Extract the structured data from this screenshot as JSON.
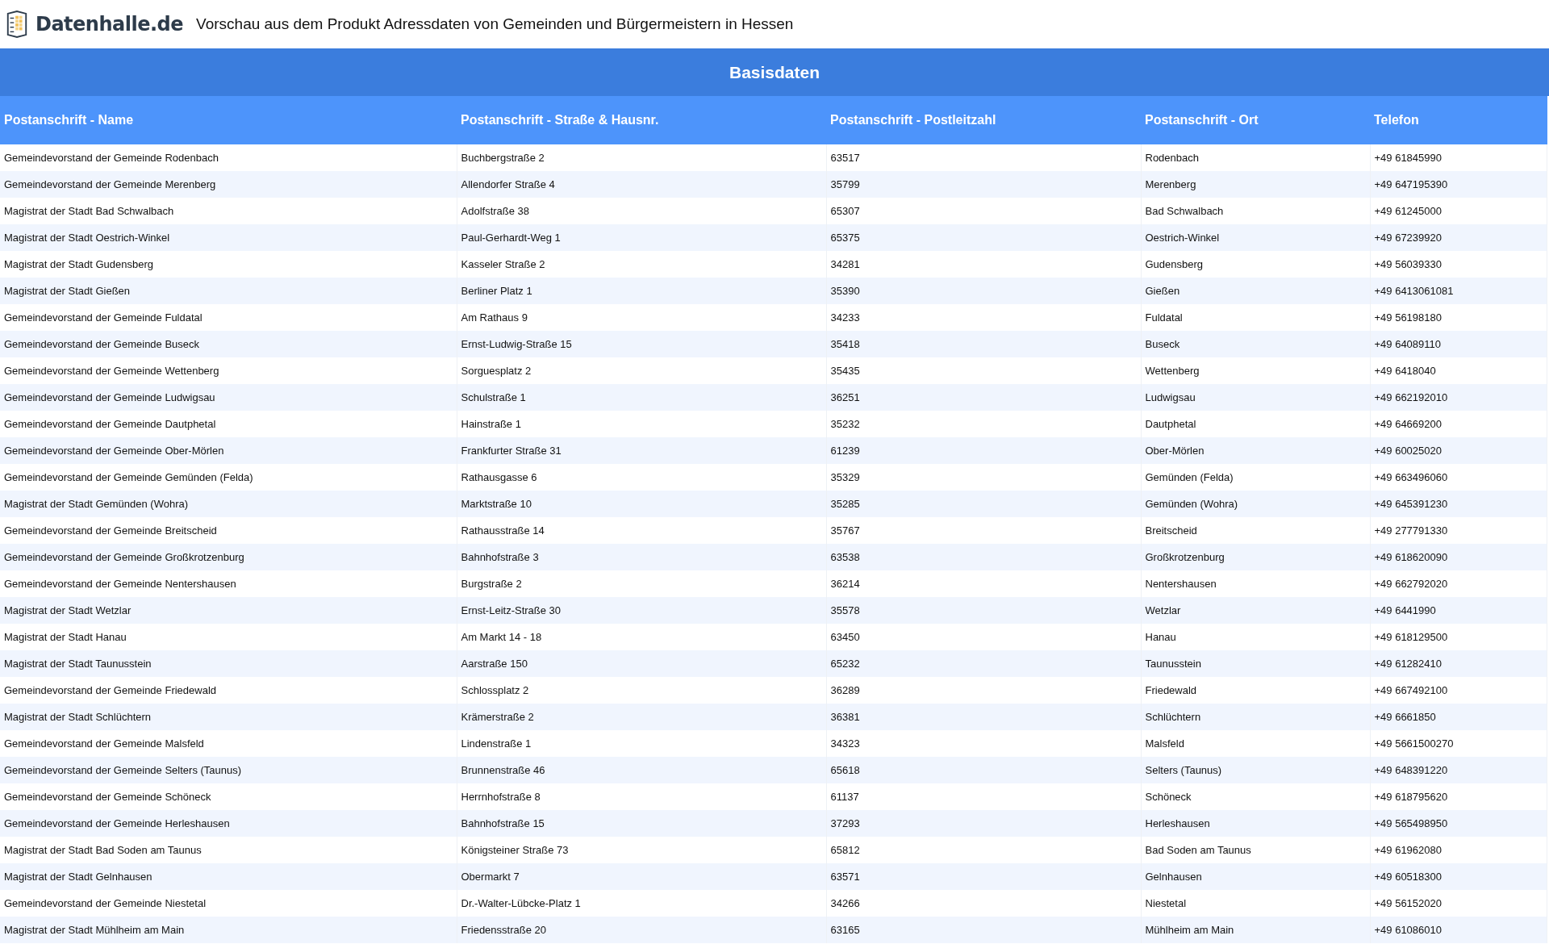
{
  "header": {
    "logo_text": "Datenhalle.de",
    "title": "Vorschau aus dem Produkt Adressdaten von Gemeinden und Bürgermeistern in Hessen"
  },
  "table": {
    "caption": "Basisdaten",
    "columns": [
      "Postanschrift - Name",
      "Postanschrift - Straße & Hausnr.",
      "Postanschrift - Postleitzahl",
      "Postanschrift - Ort",
      "Telefon"
    ],
    "rows": [
      [
        "Gemeindevorstand der Gemeinde Rodenbach",
        "Buchbergstraße 2",
        "63517",
        "Rodenbach",
        "+49 61845990"
      ],
      [
        "Gemeindevorstand der Gemeinde Merenberg",
        "Allendorfer Straße 4",
        "35799",
        "Merenberg",
        "+49 647195390"
      ],
      [
        "Magistrat der Stadt Bad Schwalbach",
        "Adolfstraße 38",
        "65307",
        "Bad Schwalbach",
        "+49 61245000"
      ],
      [
        "Magistrat der Stadt Oestrich-Winkel",
        "Paul-Gerhardt-Weg 1",
        "65375",
        "Oestrich-Winkel",
        "+49 67239920"
      ],
      [
        "Magistrat der Stadt Gudensberg",
        "Kasseler Straße 2",
        "34281",
        "Gudensberg",
        "+49 56039330"
      ],
      [
        "Magistrat der Stadt Gießen",
        "Berliner Platz 1",
        "35390",
        "Gießen",
        "+49 6413061081"
      ],
      [
        "Gemeindevorstand der Gemeinde Fuldatal",
        "Am Rathaus 9",
        "34233",
        "Fuldatal",
        "+49 56198180"
      ],
      [
        "Gemeindevorstand der Gemeinde Buseck",
        "Ernst-Ludwig-Straße 15",
        "35418",
        "Buseck",
        "+49 64089110"
      ],
      [
        "Gemeindevorstand der Gemeinde Wettenberg",
        "Sorguesplatz 2",
        "35435",
        "Wettenberg",
        "+49 6418040"
      ],
      [
        "Gemeindevorstand der Gemeinde Ludwigsau",
        "Schulstraße 1",
        "36251",
        "Ludwigsau",
        "+49 662192010"
      ],
      [
        "Gemeindevorstand der Gemeinde Dautphetal",
        "Hainstraße 1",
        "35232",
        "Dautphetal",
        "+49 64669200"
      ],
      [
        "Gemeindevorstand der Gemeinde Ober-Mörlen",
        "Frankfurter Straße 31",
        "61239",
        "Ober-Mörlen",
        "+49 60025020"
      ],
      [
        "Gemeindevorstand der Gemeinde Gemünden (Felda)",
        "Rathausgasse 6",
        "35329",
        "Gemünden (Felda)",
        "+49 663496060"
      ],
      [
        "Magistrat der Stadt Gemünden (Wohra)",
        "Marktstraße 10",
        "35285",
        "Gemünden (Wohra)",
        "+49 645391230"
      ],
      [
        "Gemeindevorstand der Gemeinde Breitscheid",
        "Rathausstraße 14",
        "35767",
        "Breitscheid",
        "+49 277791330"
      ],
      [
        "Gemeindevorstand der Gemeinde Großkrotzenburg",
        "Bahnhofstraße 3",
        "63538",
        "Großkrotzenburg",
        "+49 618620090"
      ],
      [
        "Gemeindevorstand der Gemeinde Nentershausen",
        "Burgstraße 2",
        "36214",
        "Nentershausen",
        "+49 662792020"
      ],
      [
        "Magistrat der Stadt Wetzlar",
        "Ernst-Leitz-Straße 30",
        "35578",
        "Wetzlar",
        "+49 6441990"
      ],
      [
        "Magistrat der Stadt Hanau",
        "Am Markt 14 - 18",
        "63450",
        "Hanau",
        "+49 618129500"
      ],
      [
        "Magistrat der Stadt Taunusstein",
        "Aarstraße 150",
        "65232",
        "Taunusstein",
        "+49 61282410"
      ],
      [
        "Gemeindevorstand der Gemeinde Friedewald",
        "Schlossplatz 2",
        "36289",
        "Friedewald",
        "+49 667492100"
      ],
      [
        "Magistrat der Stadt Schlüchtern",
        "Krämerstraße 2",
        "36381",
        "Schlüchtern",
        "+49 6661850"
      ],
      [
        "Gemeindevorstand der Gemeinde Malsfeld",
        "Lindenstraße 1",
        "34323",
        "Malsfeld",
        "+49 5661500270"
      ],
      [
        "Gemeindevorstand der Gemeinde Selters (Taunus)",
        "Brunnenstraße 46",
        "65618",
        "Selters (Taunus)",
        "+49 648391220"
      ],
      [
        "Gemeindevorstand der Gemeinde Schöneck",
        "Herrnhofstraße 8",
        "61137",
        "Schöneck",
        "+49 618795620"
      ],
      [
        "Gemeindevorstand der Gemeinde Herleshausen",
        "Bahnhofstraße 15",
        "37293",
        "Herleshausen",
        "+49 565498950"
      ],
      [
        "Magistrat der Stadt Bad Soden am Taunus",
        "Königsteiner Straße 73",
        "65812",
        "Bad Soden am Taunus",
        "+49 61962080"
      ],
      [
        "Magistrat der Stadt Gelnhausen",
        "Obermarkt 7",
        "63571",
        "Gelnhausen",
        "+49 60518300"
      ],
      [
        "Gemeindevorstand der Gemeinde Niestetal",
        "Dr.-Walter-Lübcke-Platz 1",
        "34266",
        "Niestetal",
        "+49 56152020"
      ],
      [
        "Magistrat der Stadt Mühlheim am Main",
        "Friedensstraße 20",
        "63165",
        "Mühlheim am Main",
        "+49 61086010"
      ]
    ]
  }
}
